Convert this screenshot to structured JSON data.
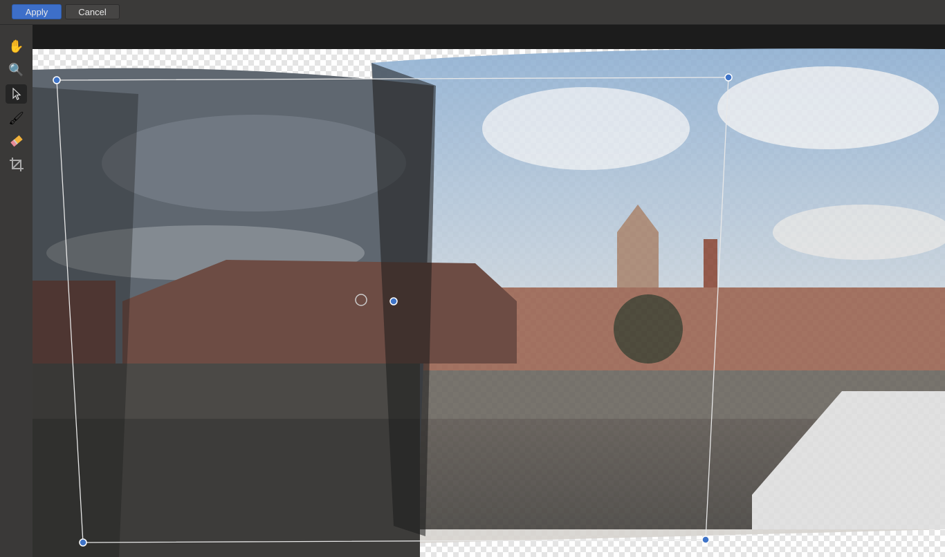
{
  "toolbar_top": {
    "apply_label": "Apply",
    "cancel_label": "Cancel"
  },
  "tools": [
    {
      "name": "hand-tool",
      "icon": "hand-icon"
    },
    {
      "name": "zoom-tool",
      "icon": "magnifier-icon"
    },
    {
      "name": "select-tool",
      "icon": "pointer-icon",
      "active": true
    },
    {
      "name": "brush-tool",
      "icon": "brush-icon"
    },
    {
      "name": "eraser-tool",
      "icon": "eraser-icon"
    },
    {
      "name": "crop-tool",
      "icon": "crop-icon"
    }
  ],
  "colors": {
    "accent": "#3d6fc9",
    "handle": "#3f74c8"
  }
}
